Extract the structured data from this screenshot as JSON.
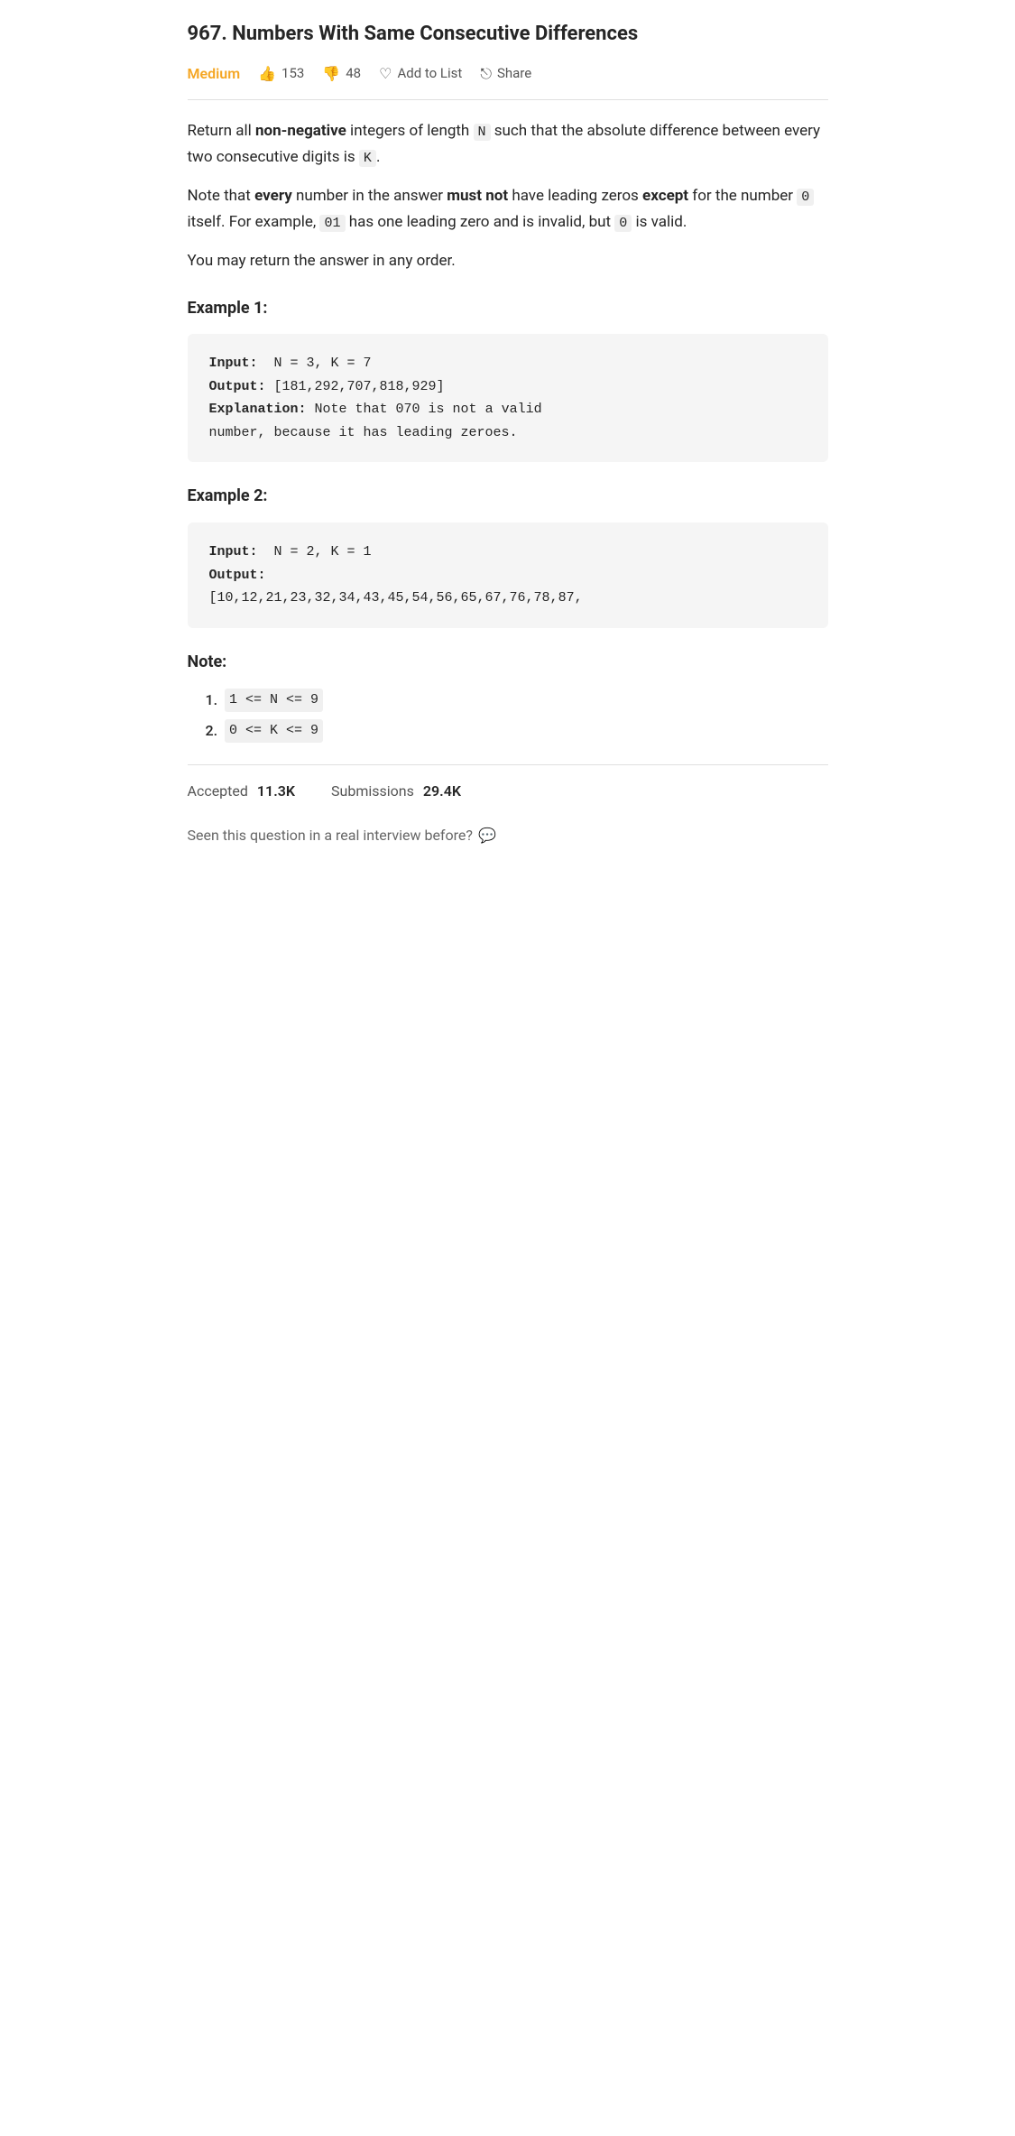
{
  "page": {
    "title": "967. Numbers With Same Consecutive Differences",
    "difficulty": "Medium",
    "likes": "153",
    "dislikes": "48",
    "add_to_list": "Add to List",
    "share": "Share",
    "description": {
      "para1_parts": [
        "Return all ",
        "non-negative",
        " integers of length ",
        "N",
        " such that the absolute difference between every two consecutive digits is ",
        "K",
        "."
      ],
      "para2_parts": [
        "Note that ",
        "every",
        " number in the answer ",
        "must not",
        " have leading zeros ",
        "except",
        " for the number ",
        "0",
        " itself. For example, ",
        "01",
        " has one leading zero and is invalid, but ",
        "0",
        " is valid."
      ],
      "para3": "You may return the answer in any order."
    },
    "examples": [
      {
        "title": "Example 1:",
        "code": "Input:  N = 3, K = 7\nOutput: [181,292,707,818,929]\nExplanation: Note that 070 is not a valid\nnumber, because it has leading zeroes."
      },
      {
        "title": "Example 2:",
        "code": "Input:  N = 2, K = 1\nOutput:\n[10,12,21,23,32,34,43,45,54,56,65,67,76,78,87,"
      }
    ],
    "note": {
      "title": "Note:",
      "items": [
        {
          "num": "1.",
          "text": "1 <= N <= 9"
        },
        {
          "num": "2.",
          "text": "0 <= K <= 9"
        }
      ]
    },
    "stats": {
      "accepted_label": "Accepted",
      "accepted_value": "11.3K",
      "submissions_label": "Submissions",
      "submissions_value": "29.4K"
    },
    "interview_question": "Seen this question in a real interview before?"
  }
}
